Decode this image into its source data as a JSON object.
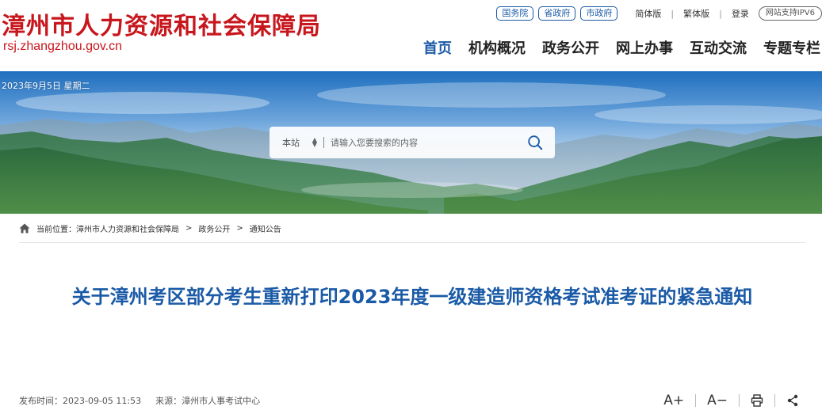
{
  "header": {
    "site_name": "漳州市人力资源和社会保障局",
    "site_url": "rsj.zhangzhou.gov.cn",
    "gov_links": [
      "国务院",
      "省政府",
      "市政府"
    ],
    "simplified": "简体版",
    "traditional": "繁体版",
    "login": "登录",
    "ipv6": "网站支持IPV6"
  },
  "nav": [
    "首页",
    "机构概况",
    "政务公开",
    "网上办事",
    "互动交流",
    "专题专栏"
  ],
  "banner": {
    "date": "2023年9月5日 星期二",
    "search_scope": "本站",
    "search_placeholder": "请输入您要搜索的内容"
  },
  "breadcrumb": {
    "label": "当前位置：",
    "items": [
      "漳州市人力资源和社会保障局",
      "政务公开",
      "通知公告"
    ],
    "sep": ">"
  },
  "article": {
    "title": "关于漳州考区部分考生重新打印2023年度一级建造师资格考试准考证的紧急通知",
    "publish_label": "发布时间：",
    "publish_time": "2023-09-05 11:53",
    "source_label": "来源：",
    "source": "漳州市人事考试中心",
    "font_larger": "A+",
    "font_smaller": "A−"
  },
  "colors": {
    "brand_red": "#c8161d",
    "brand_blue": "#1a5aa6"
  }
}
